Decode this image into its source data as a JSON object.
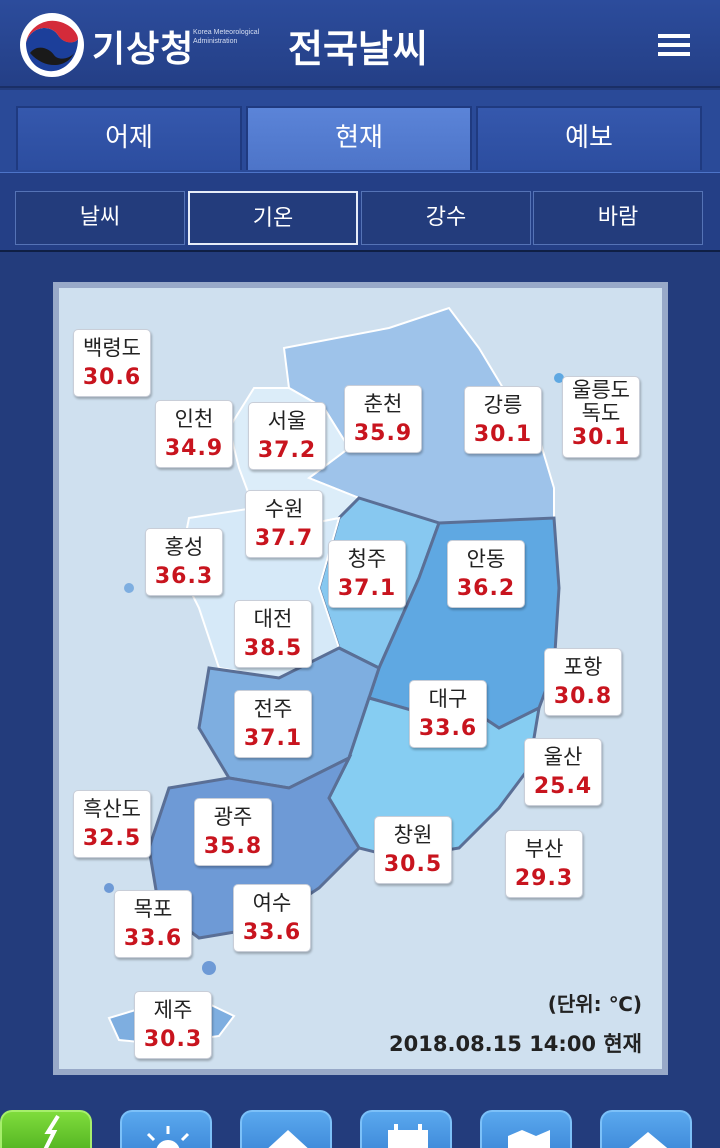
{
  "header": {
    "logo_text": "기상청",
    "logo_sub": "Korea Meteorological Administration",
    "title": "전국날씨",
    "menu_icon": "hamburger-menu-icon"
  },
  "tabs": [
    {
      "label": "어제",
      "active": false
    },
    {
      "label": "현재",
      "active": true
    },
    {
      "label": "예보",
      "active": false
    }
  ],
  "subtabs": [
    {
      "label": "날씨",
      "active": false
    },
    {
      "label": "기온",
      "active": true
    },
    {
      "label": "강수",
      "active": false
    },
    {
      "label": "바람",
      "active": false
    }
  ],
  "stations": [
    {
      "name": "백령도",
      "temp": "30.6"
    },
    {
      "name": "인천",
      "temp": "34.9"
    },
    {
      "name": "서울",
      "temp": "37.2"
    },
    {
      "name": "춘천",
      "temp": "35.9"
    },
    {
      "name": "강릉",
      "temp": "30.1"
    },
    {
      "name": "울릉도\n독도",
      "name1": "울릉도",
      "name2": "독도",
      "temp": "30.1"
    },
    {
      "name": "수원",
      "temp": "37.7"
    },
    {
      "name": "홍성",
      "temp": "36.3"
    },
    {
      "name": "청주",
      "temp": "37.1"
    },
    {
      "name": "안동",
      "temp": "36.2"
    },
    {
      "name": "대전",
      "temp": "38.5"
    },
    {
      "name": "포항",
      "temp": "30.8"
    },
    {
      "name": "대구",
      "temp": "33.6"
    },
    {
      "name": "전주",
      "temp": "37.1"
    },
    {
      "name": "울산",
      "temp": "25.4"
    },
    {
      "name": "흑산도",
      "temp": "32.5"
    },
    {
      "name": "광주",
      "temp": "35.8"
    },
    {
      "name": "창원",
      "temp": "30.5"
    },
    {
      "name": "부산",
      "temp": "29.3"
    },
    {
      "name": "목포",
      "temp": "33.6"
    },
    {
      "name": "여수",
      "temp": "33.6"
    },
    {
      "name": "제주",
      "temp": "30.3"
    }
  ],
  "unit": "(단위: ℃)",
  "timestamp": "2018.08.15 14:00 현재",
  "colors": {
    "header_bg": "#243f86",
    "tab_active": "#5b84d8",
    "temp_text": "#c8141e",
    "map_bg": "#cfe0ef"
  },
  "bottom_nav": [
    {
      "icon": "lightning-icon",
      "color": "green"
    },
    {
      "icon": "sun-icon",
      "color": "blue"
    },
    {
      "icon": "house-icon",
      "color": "blue"
    },
    {
      "icon": "calendar-icon",
      "color": "blue"
    },
    {
      "icon": "map-icon",
      "color": "blue"
    },
    {
      "icon": "home-icon",
      "color": "blue"
    }
  ]
}
